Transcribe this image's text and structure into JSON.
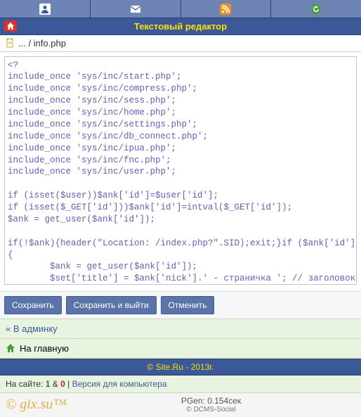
{
  "topbar": {
    "icons": [
      "user-icon",
      "mail-icon",
      "rss-icon",
      "refresh-icon"
    ]
  },
  "titlebar": {
    "title": "Текстовый редактор"
  },
  "breadcrumb": {
    "path": "... / info.php"
  },
  "editor": {
    "content": "<?\ninclude_once 'sys/inc/start.php';\ninclude_once 'sys/inc/compress.php';\ninclude_once 'sys/inc/sess.php';\ninclude_once 'sys/inc/home.php';\ninclude_once 'sys/inc/settings.php';\ninclude_once 'sys/inc/db_connect.php';\ninclude_once 'sys/inc/ipua.php';\ninclude_once 'sys/inc/fnc.php';\ninclude_once 'sys/inc/user.php';\n\nif (isset($user))$ank['id']=$user['id'];\nif (isset($_GET['id']))$ank['id']=intval($_GET['id']);\n$ank = get_user($ank['id']);\n\nif(!$ank){header(\"Location: /index.php?\".SID);exit;}if ($ank['id']==0)\n{\n        $ank = get_user($ank['id']);\n        $set['title'] = $ank['nick'].' - страничка '; // заголовок страницы\n        include_once 'sys/inc/thead.php';\n        title();"
  },
  "buttons": {
    "save": "Сохранить",
    "save_exit": "Сохранить и выйти",
    "cancel": "Отменить"
  },
  "links": {
    "back_admin": "« В админку",
    "to_main": "На главную"
  },
  "footer": {
    "copyright": "© Site.Ru - 2013г.",
    "online_prefix": "На сайте: ",
    "online_users": "1",
    "online_sep": " & ",
    "online_guests": "0",
    "version_sep": " | ",
    "version_link": "Версия для компьютера",
    "watermark": "© gix.su™",
    "pgen": "PGen: 0.154сек",
    "dcms": "© DCMS-Social"
  }
}
